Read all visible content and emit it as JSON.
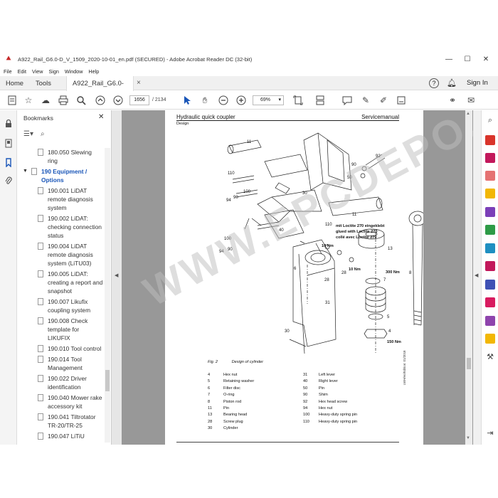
{
  "window": {
    "title": "A922_Rail_G6.0-D_V_1509_2020-10-01_en.pdf (SECURED) - Adobe Acrobat Reader DC (32-bit)",
    "controls": [
      "—",
      "☐",
      "✕"
    ]
  },
  "menu": [
    "File",
    "Edit",
    "View",
    "Sign",
    "Window",
    "Help"
  ],
  "tabs": {
    "home": "Home",
    "tools": "Tools",
    "document": "A922_Rail_G6.0-D_...",
    "close": "×",
    "help": "?",
    "sign_in": "Sign In"
  },
  "toolbar": {
    "current_page": "1656",
    "total_pages": "/ 2134",
    "zoom": "69%"
  },
  "bookmarks": {
    "title": "Bookmarks",
    "close": "✕",
    "items": [
      {
        "label": "180.050 Slewing ring",
        "group": false
      },
      {
        "label": "190 Equipment / Options",
        "group": true
      },
      {
        "label": "190.001 LiDAT remote diagnosis system",
        "group": false
      },
      {
        "label": "190.002 LiDAT: checking connection status",
        "group": false
      },
      {
        "label": "190.004 LiDAT remote diagnosis system (LiTU03)",
        "group": false
      },
      {
        "label": "190.005 LiDAT: creating a report and snapshot",
        "group": false
      },
      {
        "label": "190.007 Likufix coupling system",
        "group": false
      },
      {
        "label": "190.008 Check template for LIKUFIX",
        "group": false
      },
      {
        "label": "190.010 Tool control",
        "group": false
      },
      {
        "label": "190.014 Tool Management",
        "group": false
      },
      {
        "label": "190.022 Driver identification",
        "group": false
      },
      {
        "label": "190.040 Mower rake accessory kit",
        "group": false
      },
      {
        "label": "190.041 Tiltrotator TR-20/TR-25",
        "group": false
      },
      {
        "label": "190.047 LiTiU",
        "group": false
      }
    ]
  },
  "document": {
    "header_left": "Hydraulic quick coupler",
    "header_right": "Servicemanual",
    "header_sub": "Design",
    "loctite_note": [
      "mit Loctite 270 eingeklebt",
      "glued with Loctite 270",
      "collé avec Loctite 270"
    ],
    "torque_labels": [
      "10 Nm",
      "10 Nm",
      "300 Nm",
      "150 Nm"
    ],
    "callouts": [
      "11",
      "92",
      "90",
      "110",
      "30",
      "50",
      "100",
      "90",
      "94",
      "40",
      "11",
      "100",
      "110",
      "90",
      "94",
      "6",
      "28",
      "28",
      "13",
      "7",
      "5",
      "4",
      "8",
      "30",
      "31"
    ],
    "figure_label": "Fig. 2",
    "figure_title": "Design of cylinder",
    "parts_left": [
      {
        "num": "4",
        "name": "Hex nut"
      },
      {
        "num": "5",
        "name": "Retaining washer"
      },
      {
        "num": "6",
        "name": "Filter disc"
      },
      {
        "num": "7",
        "name": "O-ring"
      },
      {
        "num": "8",
        "name": "Piston rod"
      },
      {
        "num": "11",
        "name": "Pin"
      },
      {
        "num": "13",
        "name": "Bearing head"
      },
      {
        "num": "28",
        "name": "Screw plug"
      },
      {
        "num": "30",
        "name": "Cylinder"
      }
    ],
    "parts_right": [
      {
        "num": "31",
        "name": "Left lever"
      },
      {
        "num": "40",
        "name": "Right lever"
      },
      {
        "num": "50",
        "name": "Pin"
      },
      {
        "num": "90",
        "name": "Shim"
      },
      {
        "num": "92",
        "name": "Hex head screw"
      },
      {
        "num": "94",
        "name": "Hex nut"
      },
      {
        "num": "100",
        "name": "Heavy-duty spring pin"
      },
      {
        "num": "110",
        "name": "Heavy-duty spring pin"
      }
    ],
    "side_code": "LWH/en/Edition: 01/2018",
    "watermark": "WWW.EPCDEPO.COM"
  },
  "colors": {
    "accent_blue": "#1a56b8",
    "acrobat_red": "#c62828",
    "viewport_gray": "#989898"
  }
}
